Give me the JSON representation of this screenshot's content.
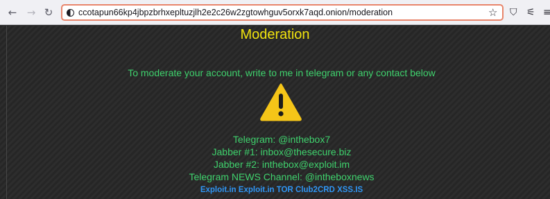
{
  "browser": {
    "url": "ccotapun66kp4jbpzbrhxepltuzjlh2e2c26w2zgtowhguv5orxk7aqd.onion/moderation"
  },
  "page": {
    "heading": "Moderation",
    "intro": "To moderate your account, write to me in telegram or any contact below",
    "warning_icon": "warning-triangle-icon",
    "contacts": [
      "Telegram: @inthebox7",
      "Jabber #1: inbox@thesecure.biz",
      "Jabber #2: inthebox@exploit.im",
      "Telegram NEWS Channel: @intheboxnews"
    ],
    "links": [
      "Exploit.in",
      "Exploit.in TOR",
      "Club2CRD",
      "XSS.IS"
    ],
    "colors": {
      "heading": "#f1e30e",
      "text": "#3fd26d",
      "link": "#2f95f3",
      "warning": "#f5c518"
    }
  }
}
